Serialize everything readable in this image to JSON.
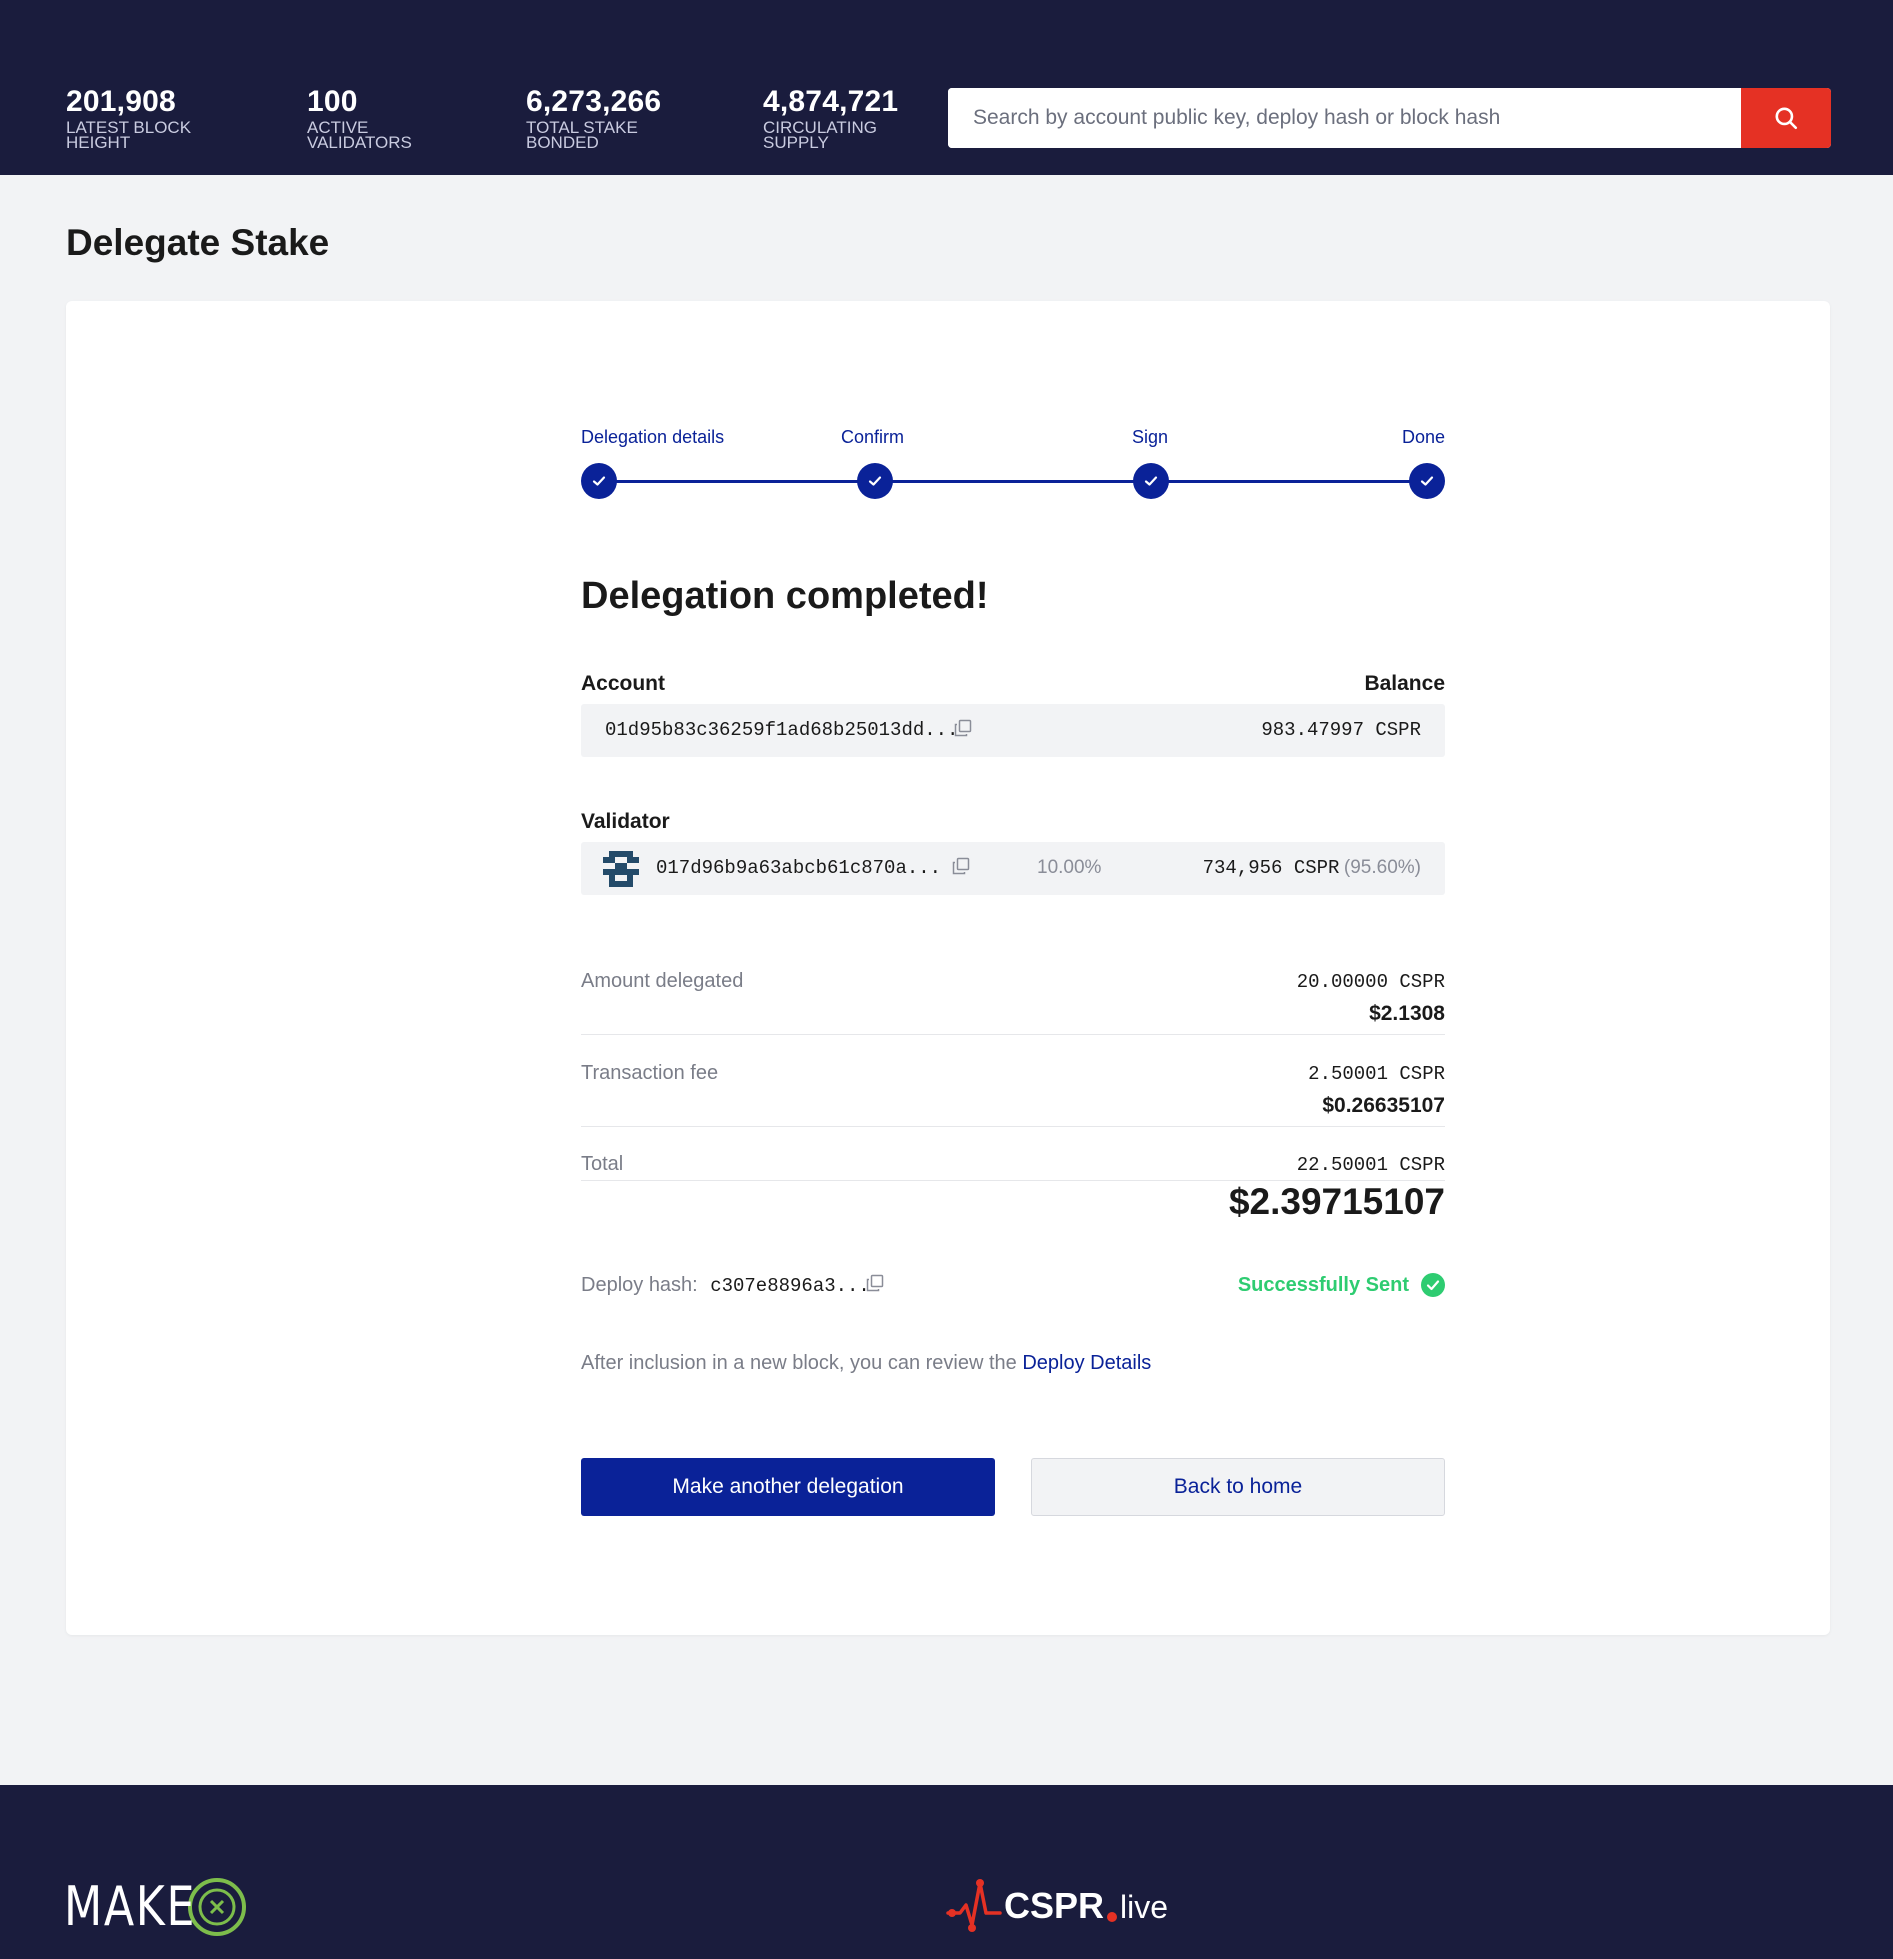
{
  "header": {
    "stats": [
      {
        "value": "201,908",
        "label": "LATEST BLOCK\nHEIGHT"
      },
      {
        "value": "100",
        "label": "ACTIVE\nVALIDATORS"
      },
      {
        "value": "6,273,266",
        "label": "TOTAL STAKE\nBONDED"
      },
      {
        "value": "4,874,721",
        "label": "CIRCULATING\nSUPPLY"
      }
    ],
    "search": {
      "placeholder": "Search by account public key, deploy hash or block hash",
      "value": ""
    }
  },
  "page": {
    "title": "Delegate Stake"
  },
  "stepper": {
    "steps": [
      {
        "label": "Delegation details"
      },
      {
        "label": "Confirm"
      },
      {
        "label": "Sign"
      },
      {
        "label": "Done"
      }
    ]
  },
  "result": {
    "title": "Delegation completed!",
    "account_label": "Account",
    "balance_label": "Balance",
    "account_key": "01d95b83c36259f1ad68b25013dd...",
    "balance": "983.47997 CSPR",
    "validator_label": "Validator",
    "validator_key": "017d96b9a63abcb61c870a...",
    "validator_fee": "10.00%",
    "validator_stake": "734,956 CSPR",
    "validator_stake_pct": "(95.60%)",
    "amount_label": "Amount delegated",
    "amount_cspr": "20.00000 CSPR",
    "amount_usd": "$2.1308",
    "fee_label": "Transaction fee",
    "fee_cspr": "2.50001 CSPR",
    "fee_usd": "$0.26635107",
    "total_label": "Total",
    "total_cspr": "22.50001 CSPR",
    "total_usd": "$2.39715107",
    "deploy_hash_label": "Deploy hash:",
    "deploy_hash": "c307e8896a3...",
    "status": "Successfully Sent",
    "info_text": "After inclusion in a new block, you can review the",
    "info_link": "Deploy Details",
    "primary_button": "Make another delegation",
    "secondary_button": "Back to home"
  },
  "footer": {
    "make_logo": "MAKE",
    "cspr_logo": "CSPR",
    "cspr_logo_suffix": "live"
  },
  "colors": {
    "navy": "#1a1c3d",
    "accent_blue": "#0a2298",
    "search_red": "#e53124",
    "success_green": "#2ecc71"
  }
}
